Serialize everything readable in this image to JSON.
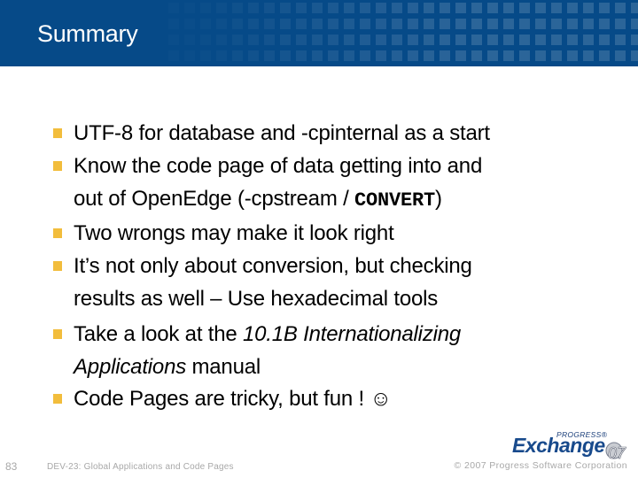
{
  "slide": {
    "title": "Summary",
    "bullets": [
      {
        "parts": [
          {
            "text": "UTF-8 for database and -cpinternal as a start",
            "style": "normal"
          }
        ]
      },
      {
        "parts": [
          {
            "text": "Know the code page of data getting into and",
            "style": "normal"
          }
        ],
        "line2": [
          {
            "text": "out of OpenEdge (-cpstream / ",
            "style": "normal"
          },
          {
            "text": "CONVERT",
            "style": "mono"
          },
          {
            "text": ")",
            "style": "normal"
          }
        ]
      },
      {
        "parts": [
          {
            "text": "Two wrongs may make it look right",
            "style": "normal"
          }
        ]
      },
      {
        "parts": [
          {
            "text": "It’s not only about conversion, but checking",
            "style": "normal"
          }
        ],
        "line2": [
          {
            "text": "results as well – Use hexadecimal tools",
            "style": "normal"
          }
        ]
      },
      {
        "parts": [
          {
            "text": "Take a look at the ",
            "style": "normal"
          },
          {
            "text": "10.1B Internationalizing",
            "style": "italic"
          }
        ],
        "line2": [
          {
            "text": "Applications",
            "style": "italic"
          },
          {
            "text": " manual",
            "style": "normal"
          }
        ]
      },
      {
        "parts": [
          {
            "text": "Code Pages are tricky, but fun ! ",
            "style": "normal"
          },
          {
            "text": "☺",
            "style": "normal"
          }
        ]
      }
    ]
  },
  "footer": {
    "slide_number": "83",
    "session_title": "DEV-23: Global Applications and Code Pages",
    "copyright": "© 2007 Progress Software Corporation"
  },
  "logo": {
    "brand_small": "PROGRESS®",
    "brand_large": "Exchange",
    "year": "07",
    "icon": "progress-exchange-logo"
  },
  "colors": {
    "header_bg": "#064a88",
    "bullet_marker": "#f2bd3c",
    "footer_text": "#a8a8a8"
  }
}
